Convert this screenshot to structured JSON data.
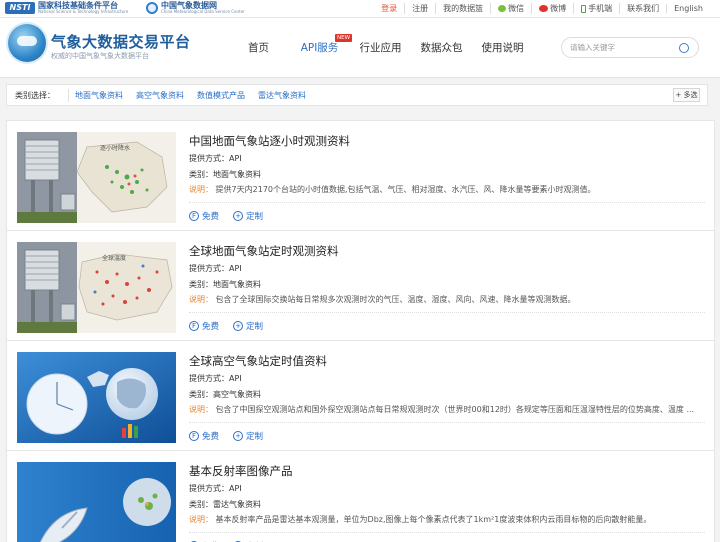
{
  "topbar": {
    "partner1": {
      "logo": "NSTI",
      "cn": "国家科技基础条件平台",
      "en": "National Science & Technology Infrastructure"
    },
    "partner2": {
      "cn": "中国气象数据网",
      "en": "China Meteorological Data Service Center"
    },
    "links": [
      "登录",
      "注册",
      "我的数据篮",
      "微信",
      "微博",
      "手机端",
      "联系我们",
      "English"
    ]
  },
  "header": {
    "title": "气象大数据交易平台",
    "subtitle": "权威的中国气象气象大数据平台",
    "nav": [
      "首页",
      "API服务",
      "行业应用",
      "数据众包",
      "使用说明"
    ],
    "nav_badge": "NEW",
    "search_placeholder": "请输入关键字"
  },
  "category": {
    "label": "类别选择：",
    "items": [
      "地面气象资料",
      "高空气象资料",
      "数值模式产品",
      "雷达气象资料"
    ],
    "more": "多选"
  },
  "items": [
    {
      "title": "中国地面气象站逐小时观测资料",
      "provider": "提供方式：API",
      "category": "类别：地面气象资料",
      "desc_label": "说明：",
      "desc": "提供7天内2170个台站的小时值数据,包括气温、气压、相对湿度、水汽压、风、降水量等要素小时观测值。",
      "free": "免费",
      "custom": "定制",
      "thumb_caption": "逐小时降水"
    },
    {
      "title": "全球地面气象站定时观测资料",
      "provider": "提供方式：API",
      "category": "类别：地面气象资料",
      "desc_label": "说明：",
      "desc": "包含了全球国际交换站每日常规多次观测时次的气压、温度、湿度、风向、风速、降水量等观测数据。",
      "free": "免费",
      "custom": "定制",
      "thumb_caption": "全球温度"
    },
    {
      "title": "全球高空气象站定时值资料",
      "provider": "提供方式：API",
      "category": "类别：高空气象资料",
      "desc_label": "说明：",
      "desc": "包含了中国探空观测站点和国外探空观测站点每日常规观测时次（世界时00和12时）各规定等压面和压温湿特性层的位势高度、温度 ...",
      "free": "免费",
      "custom": "定制"
    },
    {
      "title": "基本反射率图像产品",
      "provider": "提供方式：API",
      "category": "类别：雷达气象资料",
      "desc_label": "说明：",
      "desc": "基本反射率产品是雷达基本观测量，单位为Dbz,图像上每个像素点代表了1km²1度波束体积内云雨目标物的后向散射能量。",
      "free": "免费",
      "custom": "定制"
    }
  ]
}
